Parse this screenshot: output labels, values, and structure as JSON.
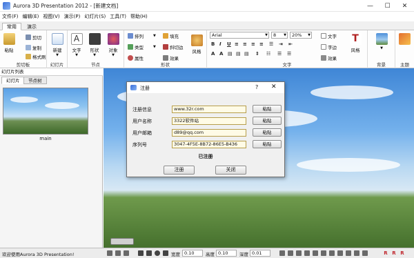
{
  "window": {
    "title": "Aurora 3D Presentation 2012 - [新建文档]",
    "minimize": "—",
    "maximize": "☐",
    "close": "✕"
  },
  "menu": [
    "文件(F)",
    "编辑(E)",
    "视图(V)",
    "演示(P)",
    "幻灯片(S)",
    "工具(T)",
    "帮助(H)"
  ],
  "ribbon_tabs": [
    "常用",
    "演示"
  ],
  "ribbon": {
    "clipboard": {
      "label": "剪切板",
      "paste": "粘贴",
      "cut": "剪切",
      "copy": "复制",
      "format_brush": "格式刷"
    },
    "slides": {
      "label": "幻灯片",
      "new": "新建"
    },
    "nodes": {
      "label": "节点",
      "text": "文字",
      "shape": "形状",
      "object": "对象"
    },
    "shape": {
      "label": "形状",
      "arrange": "排列",
      "type": "类型",
      "property": "属性",
      "fill": "填充",
      "bevel": "斜切边",
      "effect": "效果",
      "style": "风格"
    },
    "text": {
      "label": "文字",
      "font": "Arial",
      "size": "8",
      "zoom": "20%",
      "text_btn": "文字",
      "char_spacing": "字边",
      "effect": "效果",
      "style": "风格"
    },
    "background": {
      "label": "背景"
    },
    "theme": {
      "label": "主题"
    }
  },
  "left_panel": {
    "title": "幻灯片列表",
    "tabs": [
      "幻灯片",
      "节点树"
    ],
    "slide_label": "main"
  },
  "dialog": {
    "title": "注册",
    "help": "?",
    "close": "✕",
    "rows": [
      {
        "label": "注册信息",
        "value": "www.32r.com",
        "button": "粘贴"
      },
      {
        "label": "用户名称",
        "value": "3322软件站",
        "button": "粘贴"
      },
      {
        "label": "用户邮箱",
        "value": "         d89@qq.com",
        "button": "粘贴"
      },
      {
        "label": "序列号",
        "value": "3047-4F5E-8B72-86E5-B436",
        "button": "粘贴"
      }
    ],
    "status": "已注册",
    "register_button": "注册",
    "close_button": "关闭"
  },
  "statusbar": {
    "message": "欢迎使用Aurora 3D Presentation!",
    "width_label": "宽度",
    "width_value": "0.10",
    "height_label": "高度",
    "height_value": "0.10",
    "depth_label": "深度",
    "depth_value": "0.01",
    "reset_buttons": [
      "R",
      "R",
      "R"
    ]
  }
}
